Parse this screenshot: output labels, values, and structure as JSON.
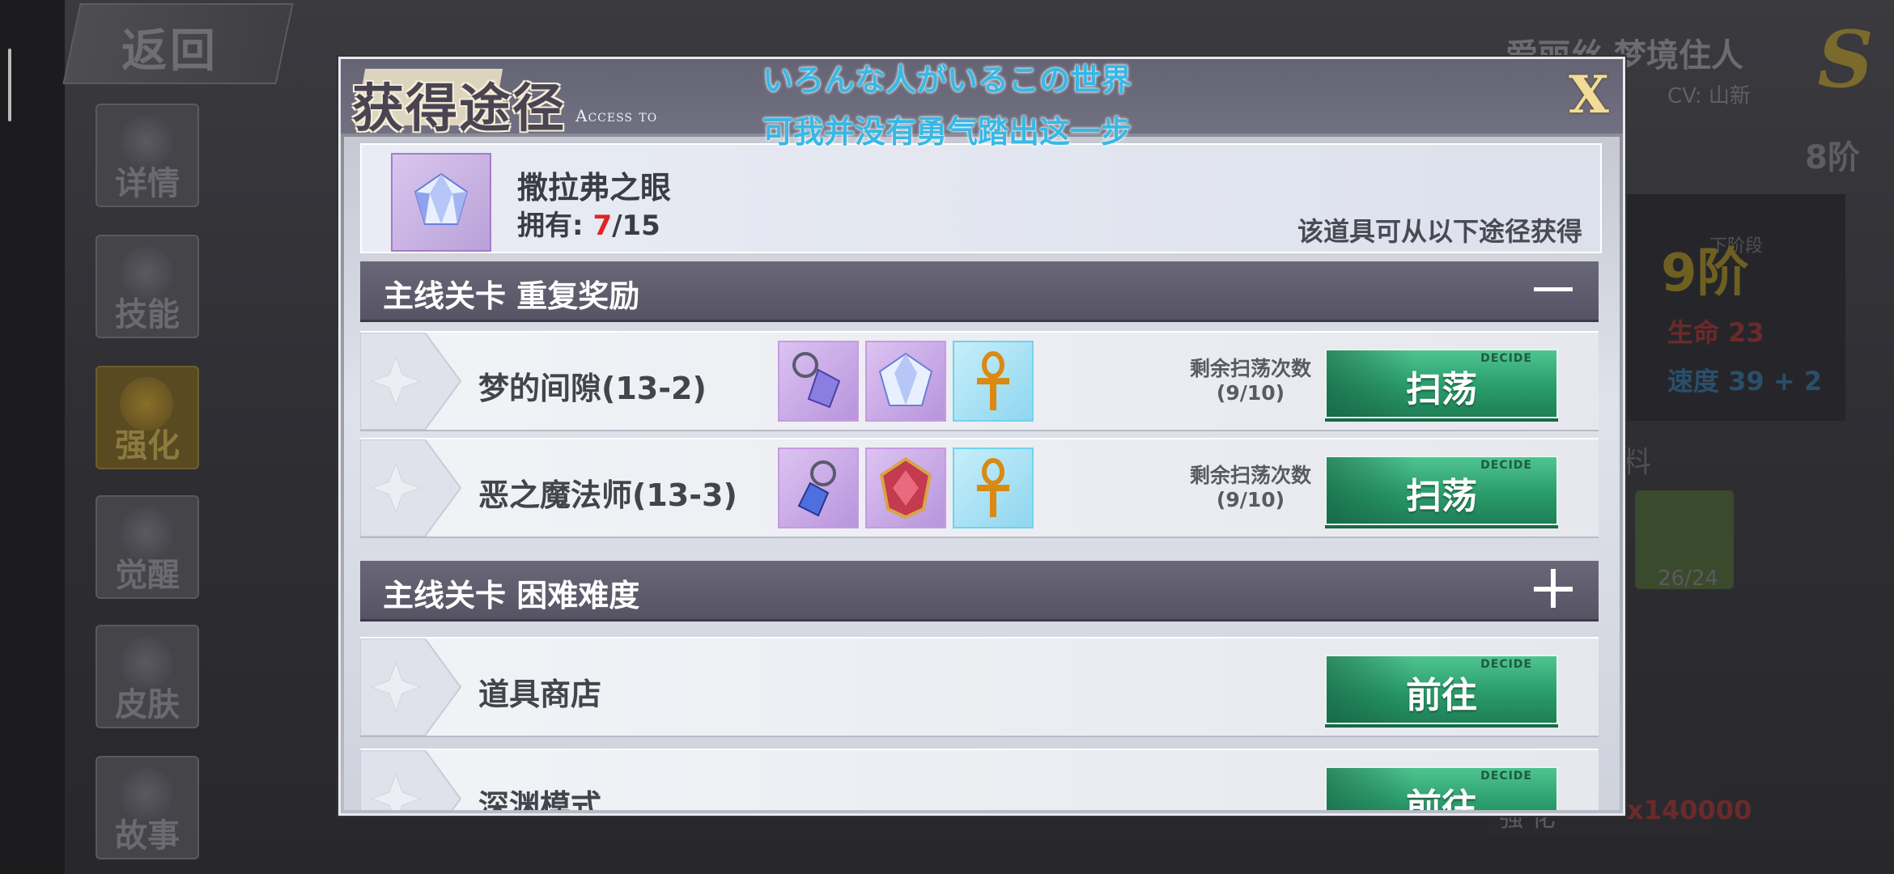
{
  "background": {
    "back_label": "返回",
    "side_menu": [
      {
        "label": "详情",
        "icon": "detail-icon",
        "active": false
      },
      {
        "label": "技能",
        "icon": "skill-icon",
        "active": false
      },
      {
        "label": "强化",
        "icon": "enhance-icon",
        "active": true
      },
      {
        "label": "觉醒",
        "icon": "awaken-icon",
        "active": false
      },
      {
        "label": "皮肤",
        "icon": "skin-icon",
        "active": false
      },
      {
        "label": "故事",
        "icon": "story-icon",
        "active": false
      }
    ],
    "character_name": "爱丽丝 梦境住人",
    "cv": "CV: 山新",
    "rank_letter": "S",
    "current_tier": "8阶",
    "next_tier_label": "下阶段",
    "next_tier": "9阶",
    "stat_hp": "生命 23",
    "stat_speed": "速度 39 + 2",
    "material_label": "材料",
    "material_count": "26/24",
    "cost_label": "强 化",
    "cost_value": "x140000"
  },
  "subtitles": {
    "line1": "いろんな人がいるこの世界",
    "line2": "可我并没有勇气踏出这一步"
  },
  "dialog": {
    "title": "获得途径",
    "subtitle": "Access to",
    "close_label": "X",
    "item": {
      "name": "撒拉弗之眼",
      "own_label": "拥有: ",
      "own_count": "7",
      "own_total": "/15",
      "hint": "该道具可从以下途径获得",
      "icon": "crystal-gem-icon"
    },
    "categories": [
      {
        "label": "主线关卡 重复奖励",
        "expanded": true
      },
      {
        "label": "主线关卡 困难难度",
        "expanded": false
      }
    ],
    "routes": [
      {
        "name": "梦的间隙(13-2)",
        "remaining_label": "剩余扫荡次数",
        "remaining_value": "(9/10)",
        "button": "扫荡",
        "rewards": [
          "amulet-icon",
          "crystal-gem-icon",
          "ankh-icon"
        ]
      },
      {
        "name": "恶之魔法师(13-3)",
        "remaining_label": "剩余扫荡次数",
        "remaining_value": "(9/10)",
        "button": "扫荡",
        "rewards": [
          "pendant-icon",
          "ruby-emblem-icon",
          "ankh-icon"
        ]
      },
      {
        "name": "道具商店",
        "button": "前往"
      },
      {
        "name": "深渊模式",
        "button": "前往"
      }
    ],
    "button_deco": "DECIDE",
    "colors": {
      "accent_green": "#2a9c6b",
      "count_red": "#e02424",
      "subtitle_blue": "#38b8e6",
      "category_bar": "#5f5d6d"
    }
  }
}
